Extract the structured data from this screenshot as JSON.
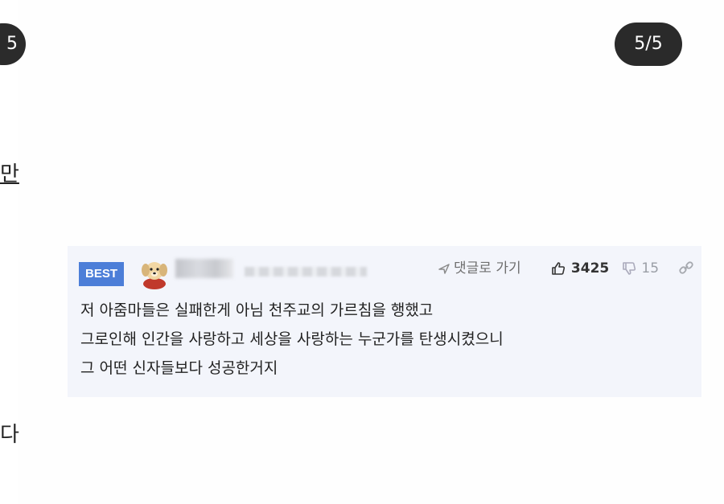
{
  "viewer": {
    "prev_counter": "5",
    "page_counter": "5/5",
    "prev_text_1": "만",
    "prev_text_2": "다"
  },
  "comment": {
    "badge": "BEST",
    "avatar_icon": "puppy-avatar-icon",
    "reply_link": "댓글로 가기",
    "like_count": "3425",
    "dislike_count": "15",
    "body_lines": [
      "저 아줌마들은 실패한게 아님 천주교의 가르침을 행했고",
      "그로인해 인간을 사랑하고 세상을 사랑하는 누군가를 탄생시켰으니",
      "그 어떤 신자들보다 성공한거지"
    ]
  },
  "colors": {
    "best_badge": "#4c7ed8",
    "card_background": "#f3f5fb",
    "counter_badge": "#2a2a2a"
  }
}
